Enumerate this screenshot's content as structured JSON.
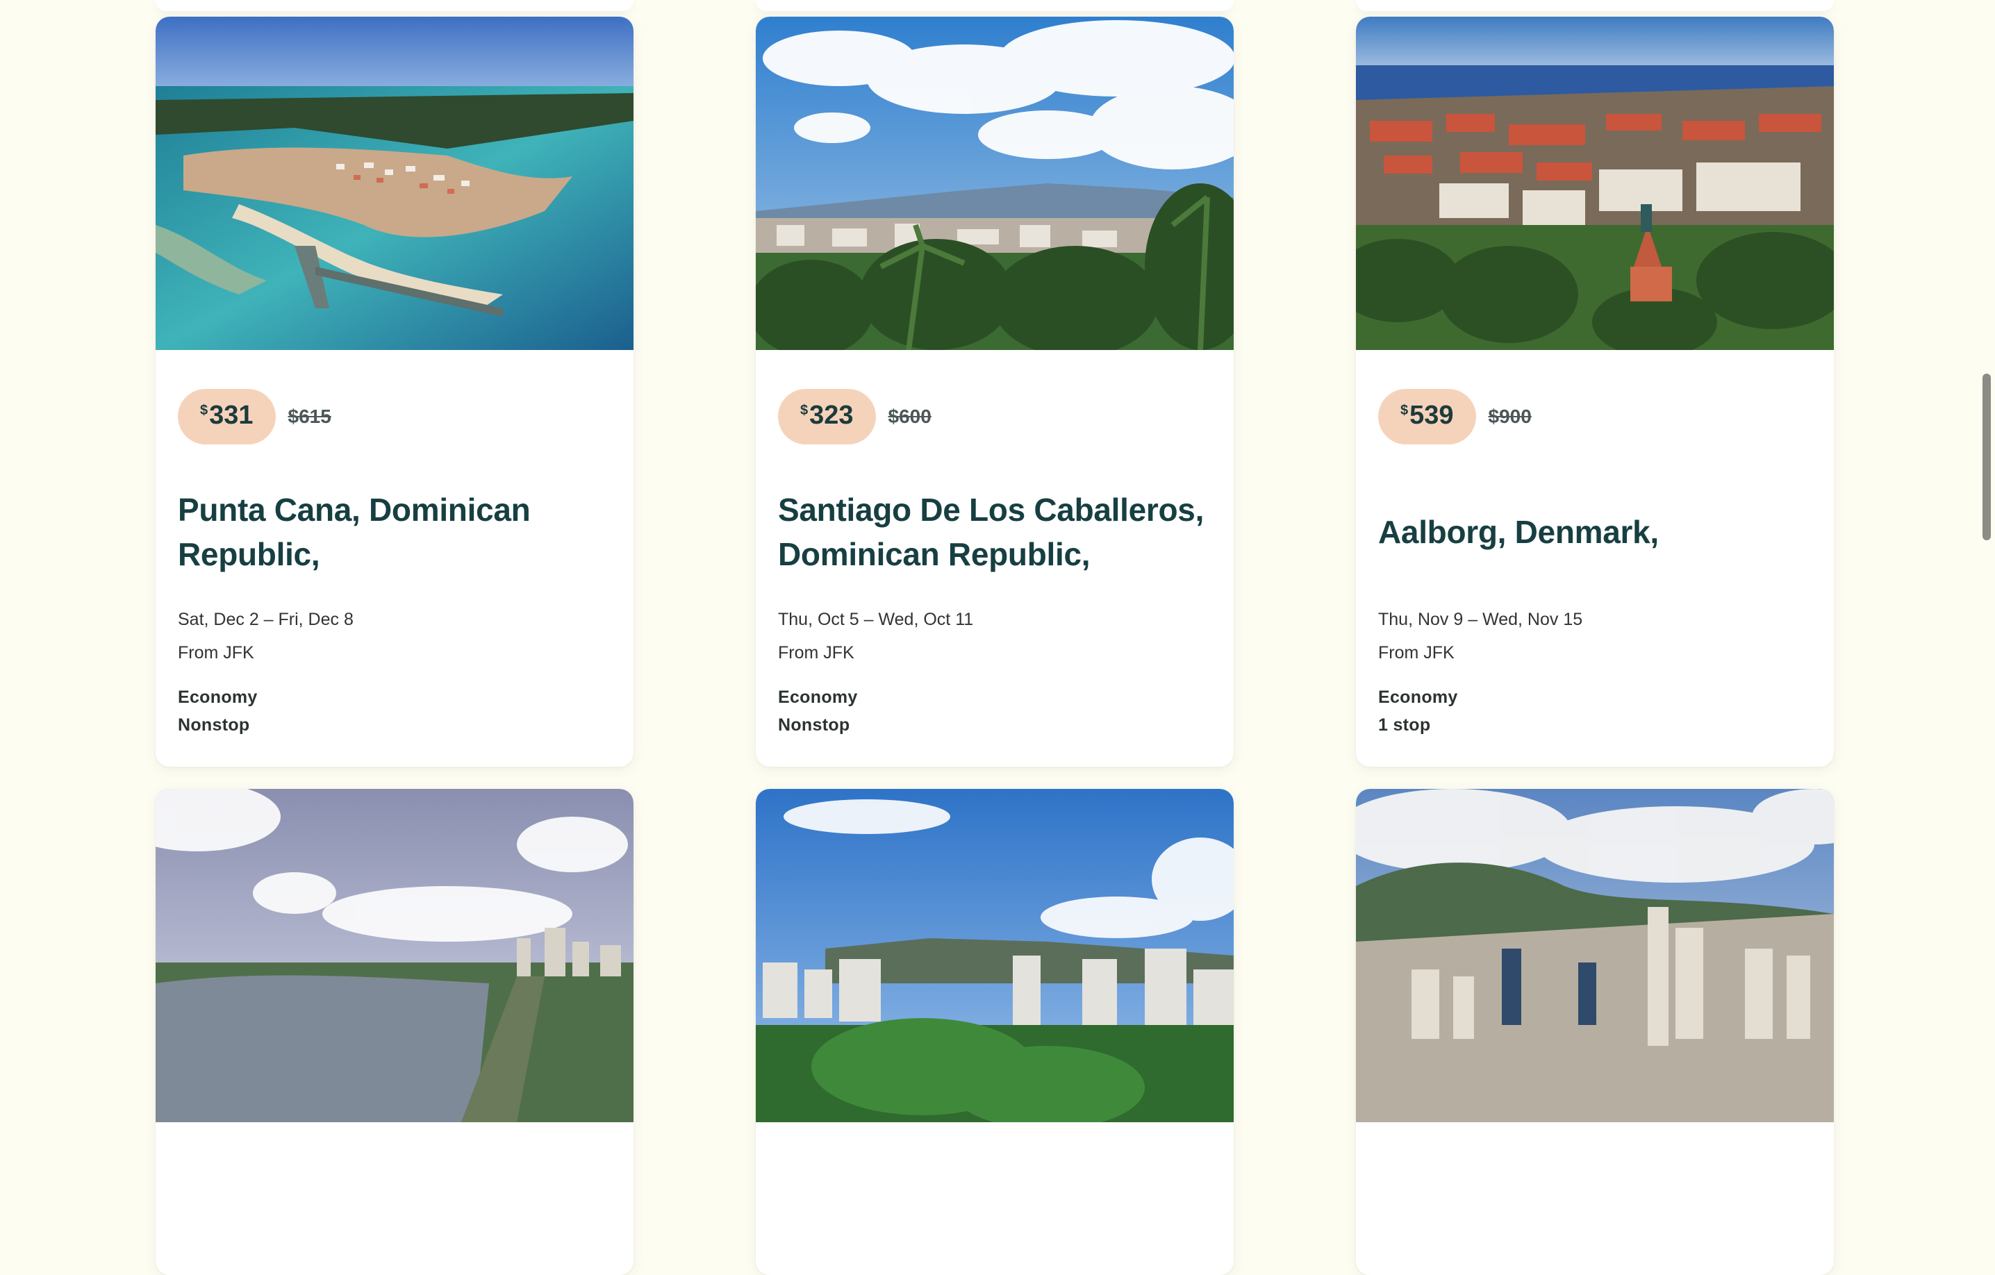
{
  "colors": {
    "page_bg": "#fefdf2",
    "price_pill_bg": "#f5d3bb",
    "title_color": "#173f42"
  },
  "cards": [
    {
      "currency": "$",
      "price": "331",
      "old_price": "$615",
      "destination": "Punta Cana, Dominican Republic,",
      "dates": "Sat, Dec 2 – Fri, Dec 8",
      "from": "From JFK",
      "cabin": "Economy",
      "stops": "Nonstop",
      "image": "aerial-coastal-marina-photo"
    },
    {
      "currency": "$",
      "price": "323",
      "old_price": "$600",
      "destination": "Santiago De Los Caballeros, Dominican Republic,",
      "dates": "Thu, Oct 5 – Wed, Oct 11",
      "from": "From JFK",
      "cabin": "Economy",
      "stops": "Nonstop",
      "image": "city-palm-trees-photo"
    },
    {
      "currency": "$",
      "price": "539",
      "old_price": "$900",
      "destination": "Aalborg, Denmark,",
      "dates": "Thu, Nov 9 – Wed, Nov 15",
      "from": "From JFK",
      "cabin": "Economy",
      "stops": "1 stop",
      "image": "city-rooftops-harbor-photo"
    }
  ],
  "row2_images": [
    "lagoon-city-skyline-photo",
    "city-green-park-mountains-photo",
    "dense-city-mountains-photo"
  ]
}
